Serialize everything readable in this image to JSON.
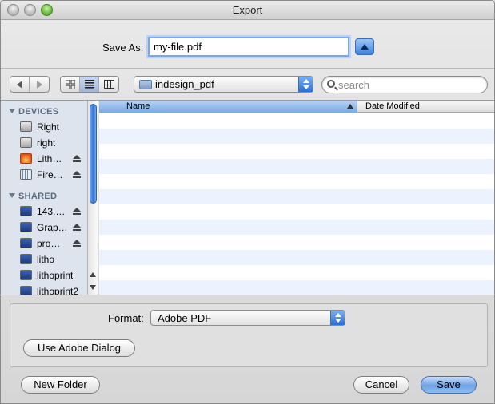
{
  "window": {
    "title": "Export"
  },
  "save_as": {
    "label": "Save As:",
    "value": "my-file.pdf"
  },
  "toolbar": {
    "back_icon": "arrow-left",
    "forward_icon": "arrow-right",
    "view_icons": [
      "icon-view",
      "list-view",
      "column-view"
    ],
    "folder": "indesign_pdf",
    "search_placeholder": "search"
  },
  "sidebar": {
    "devices_header": "DEVICES",
    "devices": [
      {
        "label": "Right",
        "icon": "hard-disk-icon",
        "eject": false
      },
      {
        "label": "right",
        "icon": "hard-disk-icon",
        "eject": false
      },
      {
        "label": "Lith…",
        "icon": "fire-disk-icon",
        "eject": true
      },
      {
        "label": "Fire…",
        "icon": "firewire-disk-icon",
        "eject": true
      }
    ],
    "shared_header": "SHARED",
    "shared": [
      {
        "label": "143.…",
        "eject": true
      },
      {
        "label": "Grap…",
        "eject": true
      },
      {
        "label": "pro…",
        "eject": true
      },
      {
        "label": "litho",
        "eject": false
      },
      {
        "label": "lithoprint",
        "eject": false
      },
      {
        "label": "lithoprint2",
        "eject": false
      }
    ]
  },
  "file_list": {
    "columns": [
      "Name",
      "Date Modified"
    ],
    "sorted_by": "Name"
  },
  "options": {
    "format_label": "Format:",
    "format_value": "Adobe PDF",
    "adobe_dialog_button": "Use Adobe Dialog"
  },
  "footer": {
    "new_folder": "New Folder",
    "cancel": "Cancel",
    "save": "Save"
  },
  "colors": {
    "accent": "#3f84dc",
    "sidebar_bg": "#dde4ee",
    "row_alt": "#edf3fe"
  }
}
